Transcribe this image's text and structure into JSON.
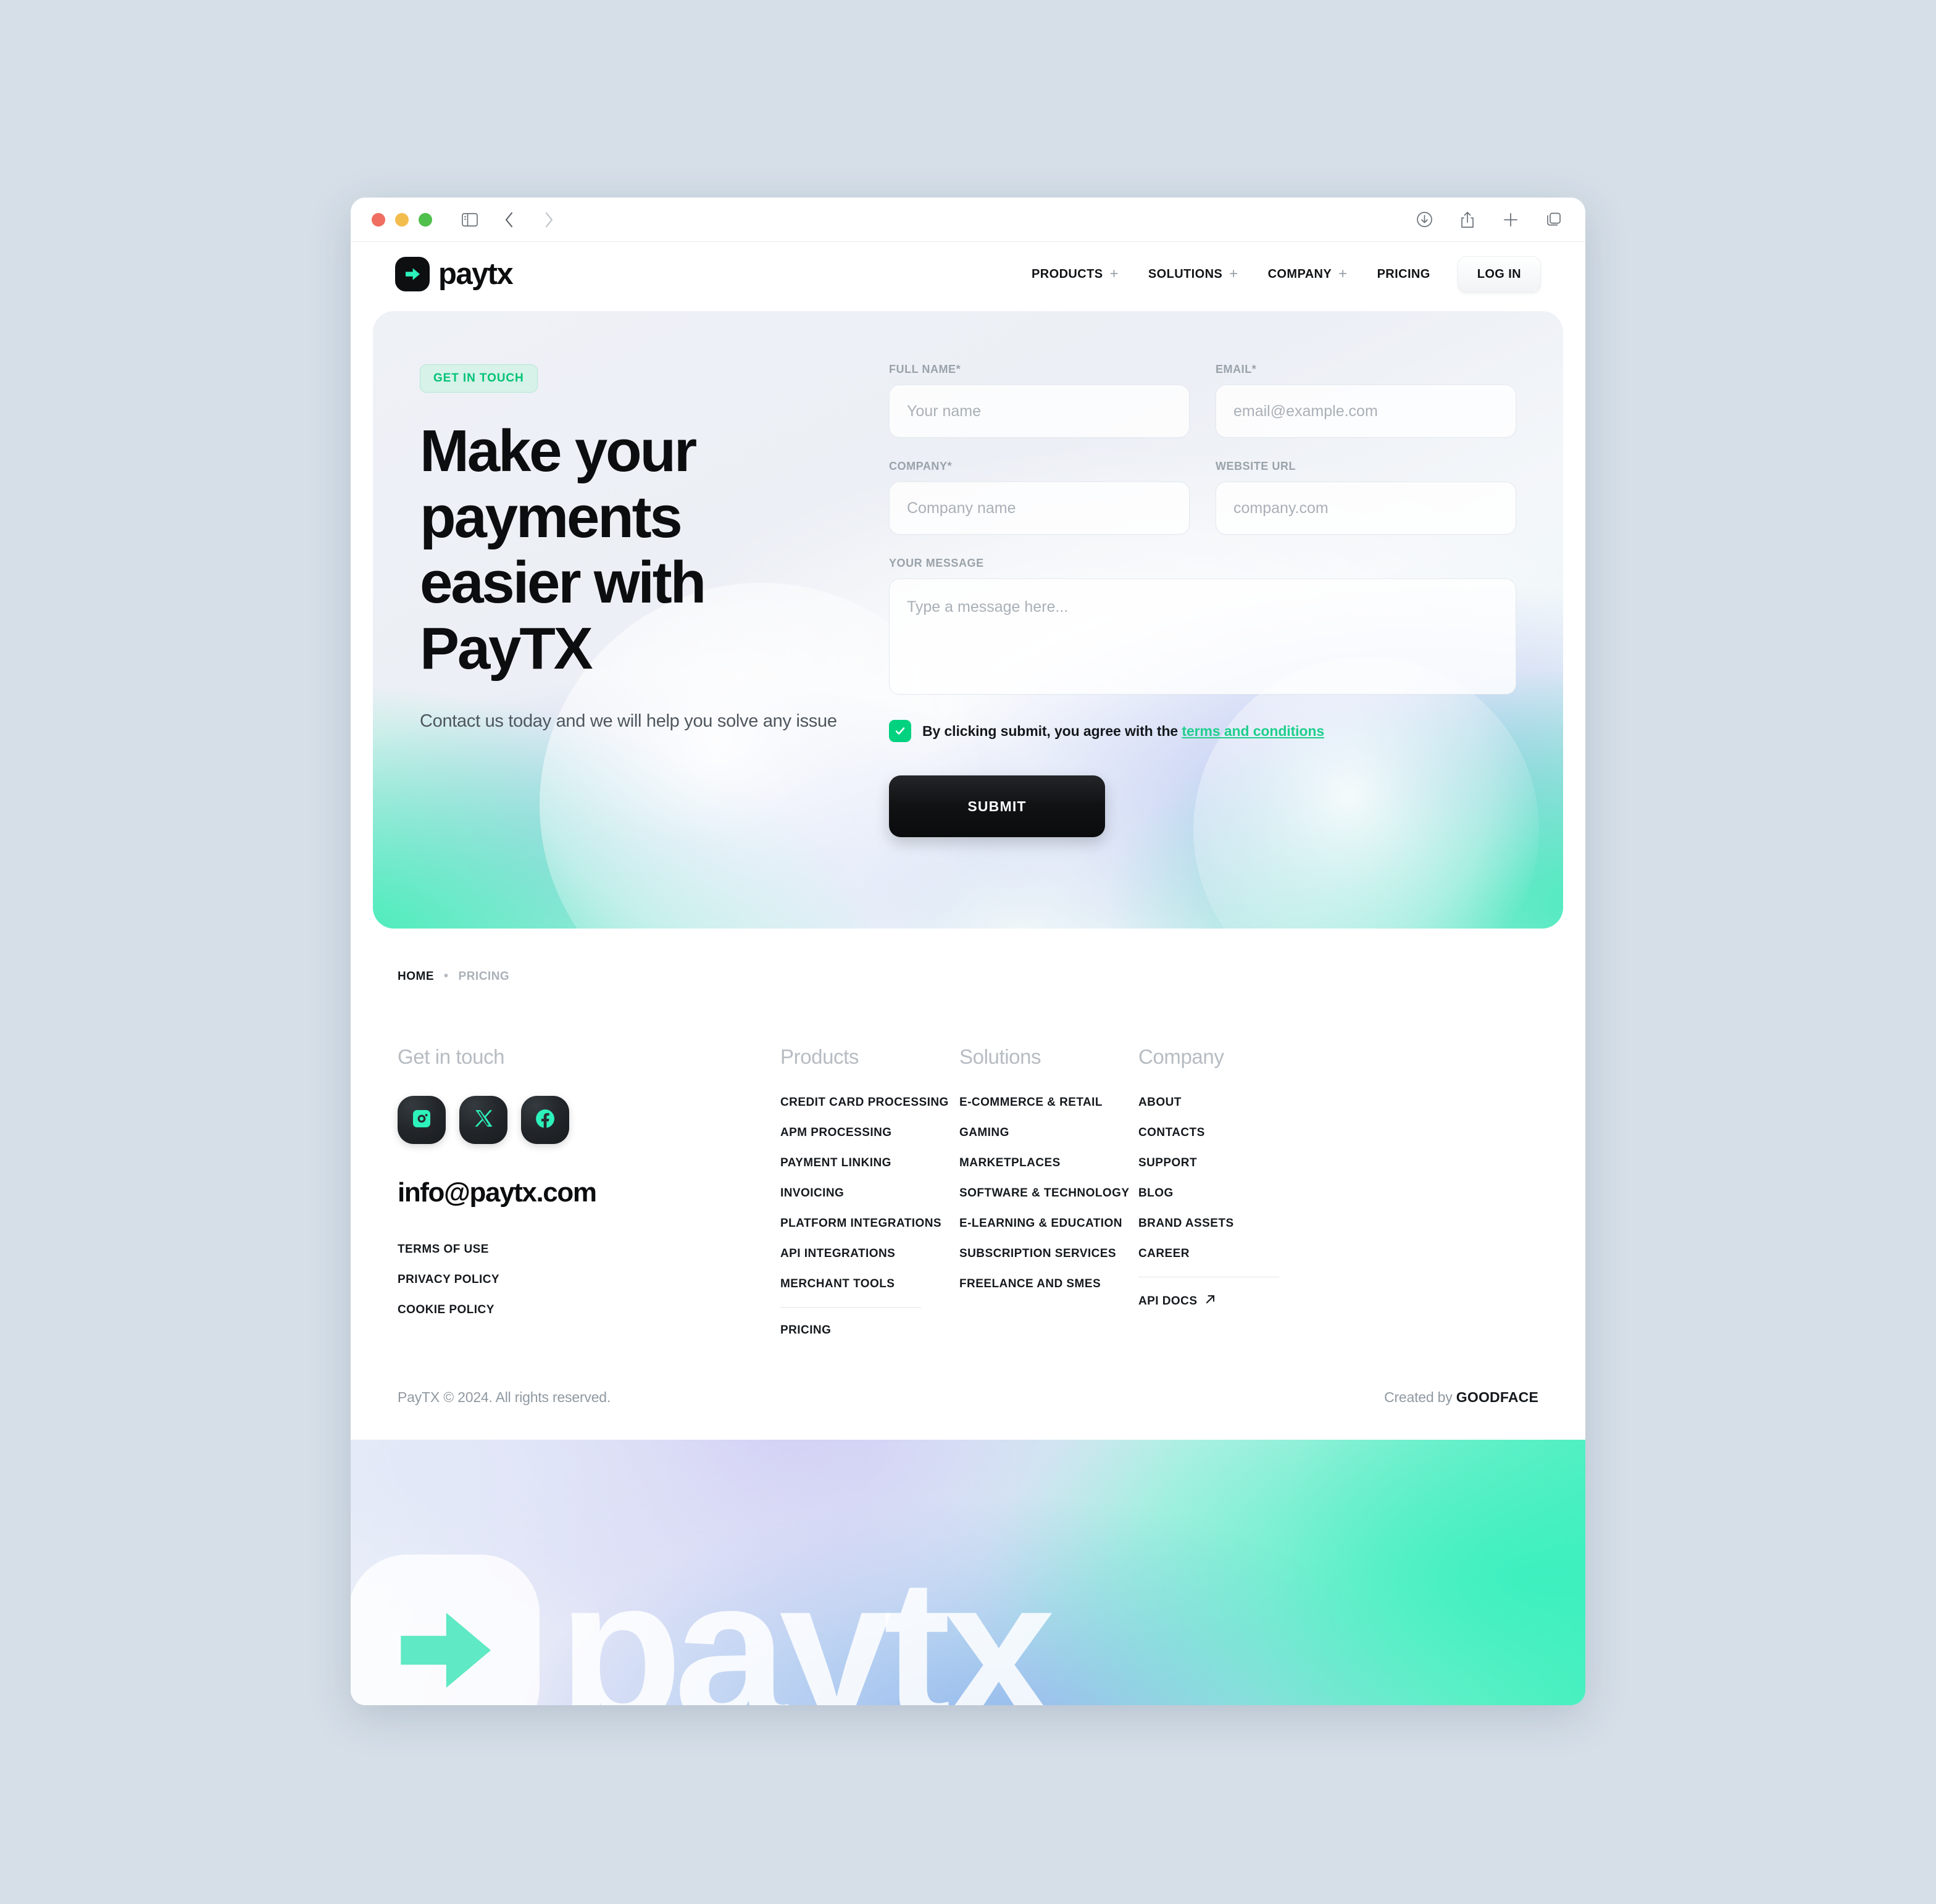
{
  "browser": {
    "window_controls": [
      "close",
      "minimize",
      "maximize"
    ],
    "left_icons": [
      "sidebar-icon",
      "back-icon",
      "forward-icon"
    ],
    "right_icons": [
      "downloads-icon",
      "share-icon",
      "new-tab-icon",
      "tab-overview-icon"
    ]
  },
  "header": {
    "logo_text": "paytx",
    "nav": [
      {
        "label": "PRODUCTS",
        "has_plus": true
      },
      {
        "label": "SOLUTIONS",
        "has_plus": true
      },
      {
        "label": "COMPANY",
        "has_plus": true
      },
      {
        "label": "PRICING",
        "has_plus": false
      }
    ],
    "login_label": "LOG IN"
  },
  "hero": {
    "badge": "GET IN TOUCH",
    "title": "Make your payments easier with PayTX",
    "subtitle": "Contact us today and we will help you solve any issue"
  },
  "form": {
    "fields": {
      "full_name": {
        "label": "FULL NAME*",
        "placeholder": "Your name",
        "value": ""
      },
      "email": {
        "label": "EMAIL*",
        "placeholder": "email@example.com",
        "value": ""
      },
      "company": {
        "label": "COMPANY*",
        "placeholder": "Company name",
        "value": ""
      },
      "website": {
        "label": "WEBSITE URL",
        "placeholder": "company.com",
        "value": ""
      },
      "message": {
        "label": "YOUR MESSAGE",
        "placeholder": "Type a message here...",
        "value": ""
      }
    },
    "consent": {
      "checked": true,
      "text": "By clicking submit, you agree with the",
      "link_text": "terms and conditions"
    },
    "submit_label": "SUBMIT"
  },
  "breadcrumb": {
    "home": "HOME",
    "separator": "•",
    "current": "PRICING"
  },
  "footer": {
    "contact": {
      "heading": "Get in touch",
      "socials": [
        "instagram-icon",
        "x-icon",
        "facebook-icon"
      ],
      "email": "info@paytx.com",
      "legal": [
        "TERMS OF USE",
        "PRIVACY POLICY",
        "COOKIE POLICY"
      ]
    },
    "products": {
      "heading": "Products",
      "links": [
        "CREDIT CARD PROCESSING",
        "APM PROCESSING",
        "PAYMENT LINKING",
        "INVOICING",
        "PLATFORM INTEGRATIONS",
        "API INTEGRATIONS",
        "MERCHANT TOOLS"
      ],
      "extra": "PRICING"
    },
    "solutions": {
      "heading": "Solutions",
      "links": [
        "E-COMMERCE & RETAIL",
        "GAMING",
        "MARKETPLACES",
        "SOFTWARE & TECHNOLOGY",
        "E-LEARNING & EDUCATION",
        "SUBSCRIPTION SERVICES",
        "FREELANCE AND SMES"
      ]
    },
    "company": {
      "heading": "Company",
      "links": [
        "ABOUT",
        "CONTACTS",
        "SUPPORT",
        "BLOG",
        "BRAND ASSETS",
        "CAREER"
      ],
      "extra": "API DOCS"
    },
    "copyright": "PayTX © 2024. All rights reserved.",
    "credit_prefix": "Created by ",
    "credit_brand": "GOODFACE",
    "watermark_word": "paytx"
  },
  "colors": {
    "accent_green": "#00d27f",
    "link_green": "#1fcf8c",
    "badge_green": "#00c376",
    "dark": "#0c0d0f",
    "page_bg": "#d6dfe8"
  }
}
